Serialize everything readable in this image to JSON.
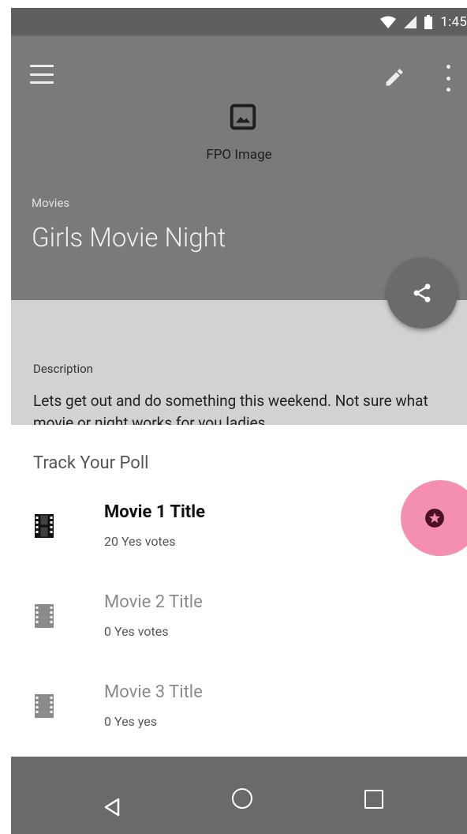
{
  "status_bar": {
    "time": "1:45"
  },
  "header": {
    "fpo_label": "FPO Image",
    "category": "Movies",
    "title": "Girls Movie Night"
  },
  "description": {
    "label": "Description",
    "text": "Lets get out and do something this weekend. Not sure what movie or night works for you ladies."
  },
  "poll": {
    "title": "Track Your Poll",
    "items": [
      {
        "title": "Movie 1 Title",
        "subtitle": "20 Yes votes"
      },
      {
        "title": "Movie 2 Title",
        "subtitle": "0 Yes votes"
      },
      {
        "title": "Movie 3 Title",
        "subtitle": "0 Yes yes"
      }
    ]
  },
  "icons": {
    "menu": "menu-icon",
    "edit": "pencil-icon",
    "more": "more-vert-icon",
    "image": "image-icon",
    "share": "share-icon",
    "film": "film-icon",
    "star_badge": "star-badge-icon"
  },
  "colors": {
    "header_bg": "#7a7a7a",
    "vote_fab": "#f48fb1",
    "nav_bar": "#6a6a6a"
  }
}
